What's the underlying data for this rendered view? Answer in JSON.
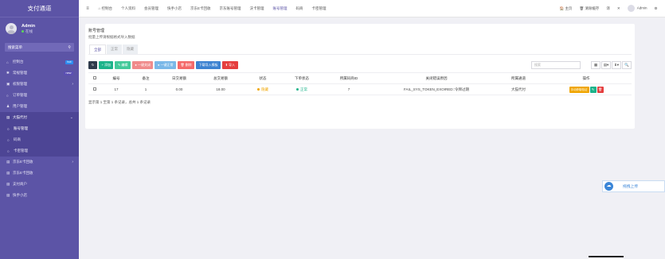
{
  "sidebar": {
    "brand": "支付通道",
    "user": {
      "name": "Admin",
      "status": "在线"
    },
    "search_label": "搜索菜单",
    "items": [
      {
        "icon": "dashboard-icon",
        "label": "控制台",
        "badge": "hot",
        "badge_color": "#2d8cf0"
      },
      {
        "icon": "settings-icon",
        "label": "常规管理",
        "badge": "new",
        "badge_color": "#5b4fb3"
      },
      {
        "icon": "permission-icon",
        "label": "权限管理",
        "arrow": "›"
      },
      {
        "icon": "order-icon",
        "label": "订单管理"
      },
      {
        "icon": "user-icon",
        "label": "用户管理"
      }
    ],
    "active_group": {
      "label": "大猫代付",
      "arrow": "⌄"
    },
    "sub_items": [
      {
        "label": "账号管理",
        "current": true
      },
      {
        "label": "码商"
      },
      {
        "label": "卡密管理"
      }
    ],
    "bottom_items": [
      {
        "label": "京东E卡回收",
        "arrow": "›"
      },
      {
        "label": "京东E卡回收"
      },
      {
        "label": "支付商户"
      },
      {
        "label": "快手小店"
      }
    ]
  },
  "topbar": {
    "nav": [
      "控制台",
      "个人资料",
      "会员管理",
      "快手小店",
      "京东E卡回收",
      "京东账号管理",
      "沃卡管理",
      "账号管理",
      "码商",
      "卡密管理"
    ],
    "active_index": 7,
    "right": [
      "主页",
      "清除缓存",
      "译",
      "✕"
    ],
    "user": "Admin"
  },
  "panel": {
    "title": "账号管理",
    "subtitle": "批量上传请根据格式导入数据",
    "tabs": [
      "全部",
      "正常",
      "隐藏"
    ],
    "buttons": [
      {
        "label": "↻",
        "color": "dark"
      },
      {
        "label": "+ 添加",
        "color": "green"
      },
      {
        "label": "✎ 编辑",
        "color": "green2"
      },
      {
        "label": "● 一键关闭",
        "color": "pink"
      },
      {
        "label": "● 一键正常",
        "color": "blue"
      },
      {
        "label": "🗑 删除",
        "color": "red"
      },
      {
        "label": "下载导入模板",
        "color": "navy"
      },
      {
        "label": "⬆ 导入",
        "color": "danger"
      }
    ],
    "search_placeholder": "搜索",
    "icon_buttons": [
      "▦",
      "▤▾",
      "⬇▾",
      "🔍"
    ],
    "table": {
      "headers": [
        "",
        "编号",
        "备注",
        "日交易额",
        "总交易额",
        "状态",
        "下单状态",
        "所属码商ID",
        "关闭错误原因",
        "所属通道",
        "操作"
      ],
      "rows": [
        {
          "id": "17",
          "note": "1",
          "day": "0.00",
          "total": "18.00",
          "status": "隐藏",
          "status_color": "#f0a500",
          "order_status": "正常",
          "order_color": "#1db38a",
          "merchant": "7",
          "reason": "FAIL_SYS_TOKEN_EXOIRED::令牌过期",
          "channel": "大猫代付",
          "op_label": "手动获取验证"
        }
      ]
    },
    "pager": "显示第 1 至第 1 条记录，总共 1 条记录"
  },
  "float": {
    "label": "拖拽上传"
  }
}
